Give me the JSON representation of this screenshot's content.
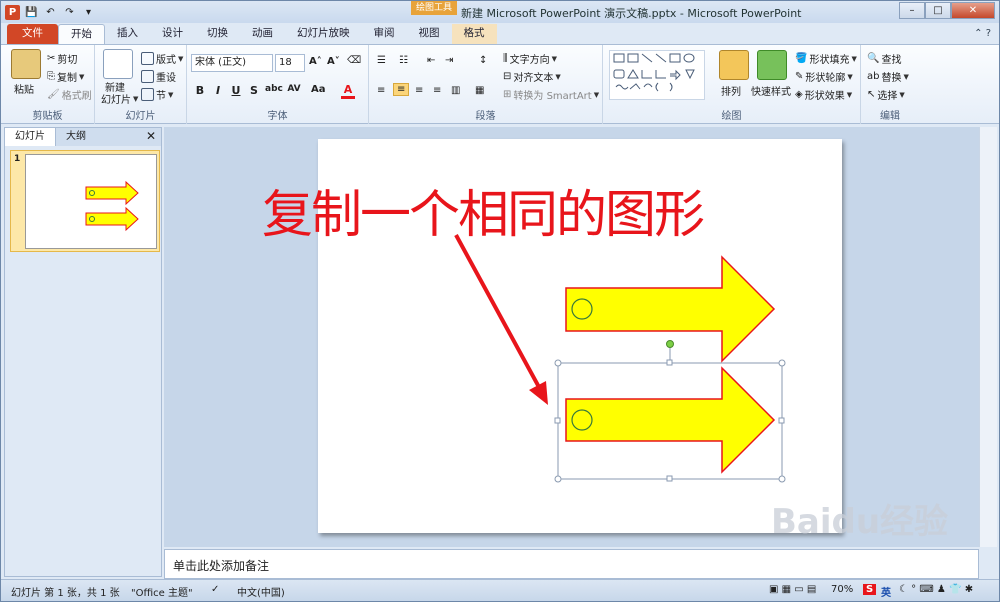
{
  "window": {
    "title": "新建 Microsoft PowerPoint 演示文稿.pptx - Microsoft PowerPoint",
    "context_tab_group": "绘图工具",
    "app_icon": "P"
  },
  "tabs": [
    "文件",
    "开始",
    "插入",
    "设计",
    "切换",
    "动画",
    "幻灯片放映",
    "审阅",
    "视图",
    "格式"
  ],
  "ribbon": {
    "clipboard": {
      "paste": "粘贴",
      "cut": "剪切",
      "copy": "复制",
      "format_painter": "格式刷",
      "label": "剪贴板"
    },
    "slides": {
      "new_slide": "新建",
      "new_slide2": "幻灯片",
      "layout": "版式",
      "reset": "重设",
      "section": "节",
      "label": "幻灯片"
    },
    "font": {
      "name": "宋体 (正文)",
      "size": "18",
      "label": "字体"
    },
    "paragraph": {
      "text_direction": "文字方向",
      "align_text": "对齐文本",
      "smartart": "转换为 SmartArt",
      "label": "段落"
    },
    "drawing": {
      "arrange": "排列",
      "quick_styles": "快速样式",
      "fill": "形状填充",
      "outline": "形状轮廓",
      "effects": "形状效果",
      "label": "绘图"
    },
    "editing": {
      "find": "查找",
      "replace": "替换",
      "select": "选择",
      "label": "编辑"
    }
  },
  "panel": {
    "tab_slides": "幻灯片",
    "tab_outline": "大纲",
    "slide_number": "1"
  },
  "slide": {
    "title": "复制一个相同的图形"
  },
  "notes": {
    "placeholder": "单击此处添加备注"
  },
  "status": {
    "slide_info": "幻灯片 第 1 张，共 1 张",
    "theme": "\"Office 主题\"",
    "language": "中文(中国)",
    "zoom": "70%",
    "ime": "英"
  },
  "watermark": {
    "text": "Baidu经验"
  },
  "colors": {
    "arrow_fill": "#ffff00",
    "arrow_stroke": "#e8151b",
    "title_color": "#e8151b",
    "file_tab": "#d24726"
  }
}
